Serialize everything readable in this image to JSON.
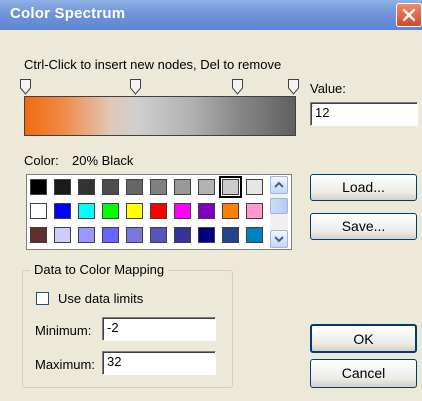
{
  "window": {
    "title": "Color Spectrum"
  },
  "instructions": "Ctrl-Click to insert new nodes, Del to remove",
  "value": {
    "label": "Value:",
    "text": "12"
  },
  "color": {
    "label": "Color:",
    "name": "20% Black"
  },
  "palette": {
    "rows": [
      [
        "#000000",
        "#1a1a1a",
        "#333333",
        "#4d4d4d",
        "#666666",
        "#808080",
        "#999999",
        "#b3b3b3",
        "#cccccc",
        "#e6e6e6"
      ],
      [
        "#ffffff",
        "#0000ff",
        "#00ffff",
        "#00ff00",
        "#ffff00",
        "#ff0000",
        "#ff00ff",
        "#8000c0",
        "#ff8000",
        "#ff99cc"
      ],
      [
        "#603030",
        "#ccccff",
        "#9999ff",
        "#6666ff",
        "#7777dd",
        "#5555bb",
        "#333399",
        "#000080",
        "#224488",
        "#0080c0"
      ]
    ],
    "selected_index": 8
  },
  "buttons": {
    "load": "Load...",
    "save": "Save...",
    "ok": "OK",
    "cancel": "Cancel"
  },
  "mapping": {
    "group_label": "Data to Color Mapping",
    "use_limits_label": "Use data limits",
    "use_limits_checked": false,
    "minimum_label": "Minimum:",
    "minimum_value": "-2",
    "maximum_label": "Maximum:",
    "maximum_value": "32"
  },
  "colors": {
    "titlebar": "#6f94d9",
    "face": "#ece9d8",
    "gradient_start": "#f26a10",
    "gradient_end": "#606060"
  }
}
